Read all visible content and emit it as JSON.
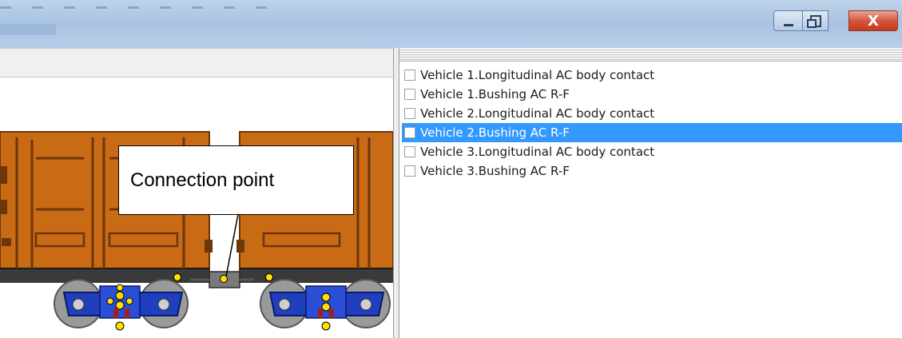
{
  "window": {
    "controls": {
      "minimize_icon": "minimize-icon",
      "maximize_icon": "restore-icon",
      "close_label": "X"
    }
  },
  "viewer": {
    "callout_text": "Connection point",
    "colors": {
      "car_body": "#c96a15",
      "bogie": "#1f3fbf",
      "joint": "#ffe000"
    }
  },
  "element_list": {
    "items": [
      {
        "label": "Vehicle 1.Longitudinal AC body contact",
        "checked": false,
        "selected": false
      },
      {
        "label": "Vehicle 1.Bushing AC  R-F",
        "checked": false,
        "selected": false
      },
      {
        "label": "Vehicle 2.Longitudinal AC body contact",
        "checked": false,
        "selected": false
      },
      {
        "label": "Vehicle 2.Bushing AC  R-F",
        "checked": false,
        "selected": true
      },
      {
        "label": "Vehicle 3.Longitudinal AC body contact",
        "checked": false,
        "selected": false
      },
      {
        "label": "Vehicle 3.Bushing AC  R-F",
        "checked": false,
        "selected": false
      }
    ],
    "selection_color": "#3399ff"
  }
}
